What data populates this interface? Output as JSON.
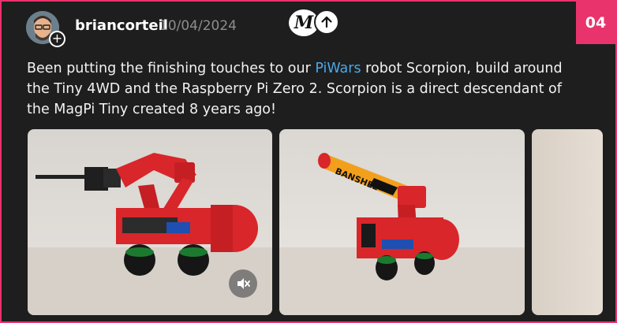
{
  "post": {
    "badge_number": "04",
    "author": "briancorteil",
    "date": "10/04/2024",
    "app_badge_letter": "M",
    "text_before_link": "Been putting the finishing touches to our ",
    "link_text": "PiWars",
    "text_after_link": " robot Scorpion, build around the Tiny 4WD and the Raspberry Pi Zero 2. Scorpion is a direct descendant of the MagPi Tiny created 8 years ago!",
    "photo2_tube_text": "BANSHEE"
  },
  "colors": {
    "accent_pink": "#e8336d",
    "link_blue": "#4aa8e8",
    "background": "#1e1e1e",
    "robot_red": "#d8262a"
  },
  "icons": [
    "plus-icon",
    "arrow-up-icon",
    "mute-icon"
  ]
}
